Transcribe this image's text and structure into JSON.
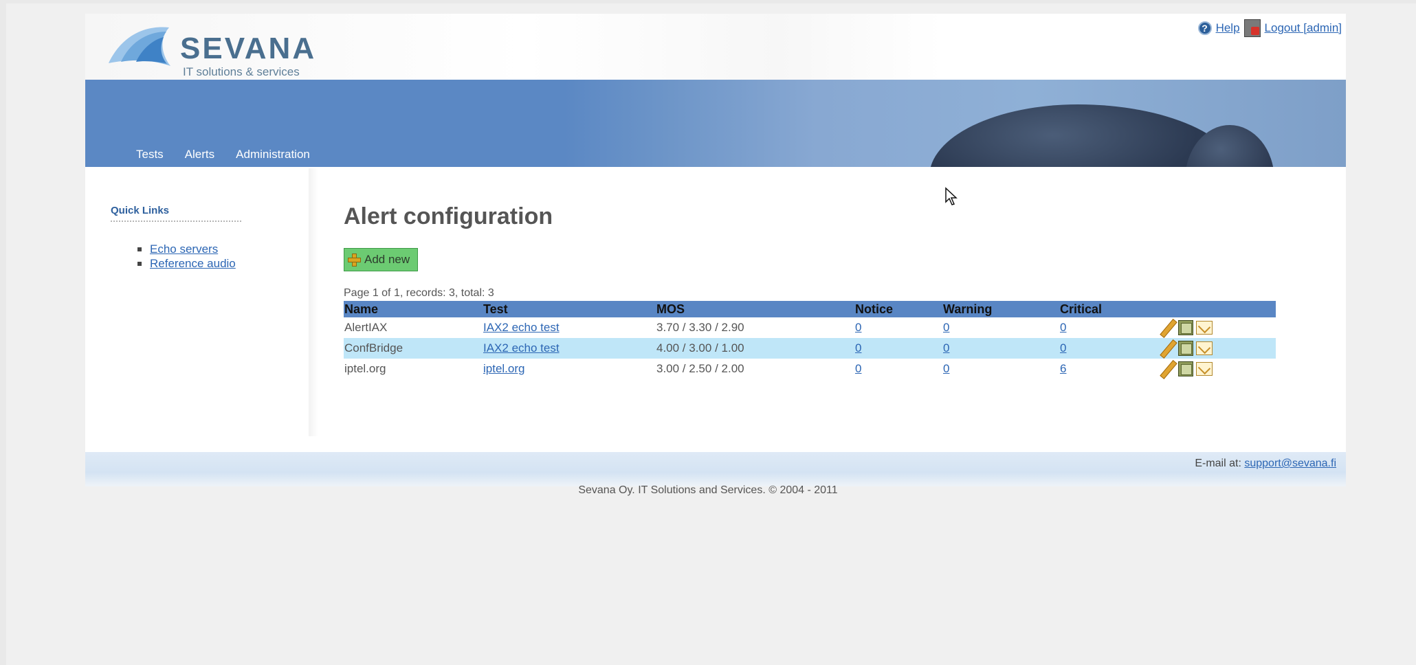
{
  "header": {
    "logo_word": "SEVANA",
    "logo_tagline": "IT solutions & services",
    "help_label": "Help",
    "logout_label": "Logout [admin]"
  },
  "nav": {
    "items": [
      {
        "label": "Tests"
      },
      {
        "label": "Alerts"
      },
      {
        "label": "Administration"
      }
    ]
  },
  "sidebar": {
    "title": "Quick Links",
    "links": [
      {
        "label": "Echo servers"
      },
      {
        "label": "Reference audio"
      }
    ]
  },
  "main": {
    "title": "Alert configuration",
    "add_new_label": "Add new",
    "pager_text": "Page 1 of 1, records: 3, total: 3",
    "columns": [
      "Name",
      "Test",
      "MOS",
      "Notice",
      "Warning",
      "Critical",
      ""
    ],
    "rows": [
      {
        "name": "AlertIAX",
        "test": "IAX2 echo test",
        "mos": "3.70 / 3.30 / 2.90",
        "notice": "0",
        "warning": "0",
        "critical": "0"
      },
      {
        "name": "ConfBridge",
        "test": "IAX2 echo test",
        "mos": "4.00 / 3.00 / 1.00",
        "notice": "0",
        "warning": "0",
        "critical": "0"
      },
      {
        "name": "iptel.org",
        "test": "iptel.org",
        "mos": "3.00 / 2.50 / 2.00",
        "notice": "0",
        "warning": "0",
        "critical": "6"
      }
    ]
  },
  "footer": {
    "email_prefix": "E-mail at: ",
    "email": "support@sevana.fi",
    "copyright": "Sevana Oy. IT Solutions and Services. © 2004 - 2011"
  },
  "colors": {
    "banner": "#5b88c4",
    "table_header": "#5986c4",
    "row_highlight": "#bfe6f8",
    "add_button": "#6ccb72",
    "link": "#2c66b4"
  }
}
